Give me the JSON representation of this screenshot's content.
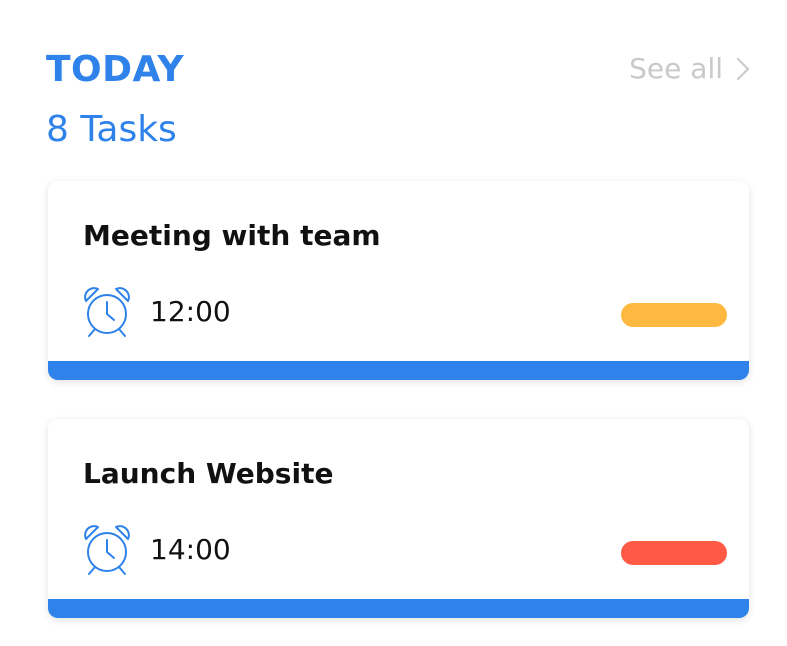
{
  "header": {
    "title": "TODAY",
    "task_count": "8 Tasks",
    "see_all_label": "See all",
    "see_all_icon": "chevron-right-icon"
  },
  "colors": {
    "accent": "#2e82ea",
    "muted": "#c9c9c9",
    "priority_medium": "#ffb840",
    "priority_high": "#ff5a45"
  },
  "tasks": [
    {
      "title": "Meeting with team",
      "time": "12:00",
      "icon": "alarm-clock-icon",
      "priority_color": "#ffb840"
    },
    {
      "title": "Launch Website",
      "time": "14:00",
      "icon": "alarm-clock-icon",
      "priority_color": "#ff5a45"
    }
  ]
}
